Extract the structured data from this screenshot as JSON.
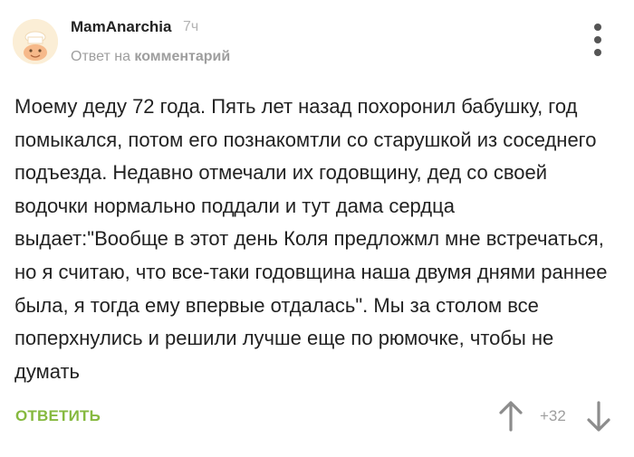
{
  "comment": {
    "author": "MamAnarchia",
    "time": "7ч",
    "reply_prefix": "Ответ на",
    "reply_link": "комментарий",
    "text": "Моему деду 72 года. Пять лет назад похоронил бабушку, год помыкался, потом его познакомтли со старушкой из соседнего подъезда. Недавно отмечали их годовщину, дед со своей водочки нормально поддали и тут дама сердца выдает:\"Вообще в этот день Коля предложмл мне встречаться, но я считаю, что все-таки годовщина наша двумя днями раннее была, я тогда ему впервые отдалась\". Мы за столом все поперхнулись и решили лучше еще по рюмочке, чтобы не думать",
    "reply_button": "ОТВЕТИТЬ",
    "rating": "+32"
  },
  "icons": {
    "avatar": "default-cook-avatar",
    "more": "more-vertical-icon",
    "upvote": "arrow-up-icon",
    "downvote": "arrow-down-icon"
  },
  "colors": {
    "accent_green": "#86b93f",
    "muted_gray": "#9e9e9e",
    "text": "#222222",
    "icon_gray": "#8c8c8c"
  }
}
